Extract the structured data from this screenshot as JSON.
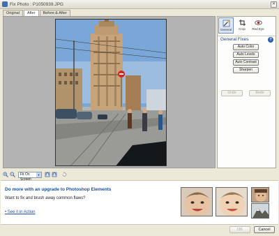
{
  "window": {
    "title": "Fix Photo : P1050939.JPG",
    "close_label": "✕"
  },
  "tabs": [
    {
      "label": "Original"
    },
    {
      "label": "After"
    },
    {
      "label": "Before & After"
    }
  ],
  "tools": [
    {
      "label": "General",
      "icon": "magic-wand-icon"
    },
    {
      "label": "Crop",
      "icon": "crop-icon"
    },
    {
      "label": "Red Eye",
      "icon": "eye-icon"
    }
  ],
  "panel": {
    "section_title": "General Fixes",
    "help_label": "?",
    "buttons": [
      "Auto Color",
      "Auto Levels",
      "Auto Contrast",
      "Sharpen"
    ],
    "undo_label": "Undo",
    "redo_label": "Redo"
  },
  "zoombar": {
    "zoom_value": "Fit On Screen"
  },
  "promo": {
    "title": "Do more with an upgrade to Photoshop Elements",
    "text": "Want to fix and brush away common flaws?",
    "link": "See it in Action"
  },
  "footer": {
    "ok_label": "OK",
    "cancel_label": "Cancel"
  },
  "colors": {
    "accent": "#1c4c9a",
    "sky": "#7aa7d8",
    "panel_bg": "#ece9d8"
  }
}
